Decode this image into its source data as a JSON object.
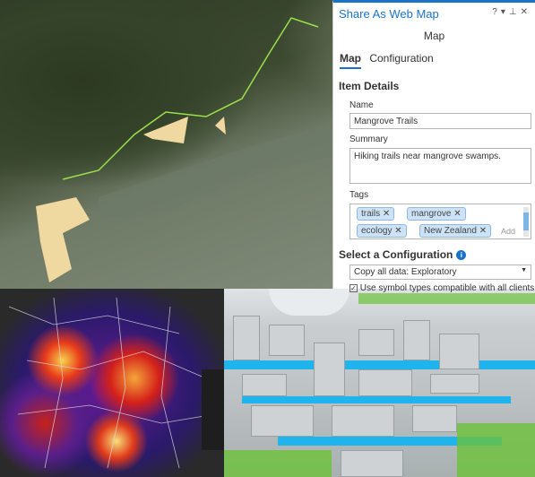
{
  "panel": {
    "title": "Share As Web Map",
    "controls": [
      "?",
      "▾",
      "⊥",
      "✕"
    ],
    "subtitle": "Map",
    "tabs": [
      {
        "label": "Map",
        "active": true
      },
      {
        "label": "Configuration",
        "active": false
      }
    ],
    "section_item_details": "Item Details",
    "name_label": "Name",
    "name_value": "Mangrove Trails",
    "summary_label": "Summary",
    "summary_value": "Hiking trails near mangrove swamps.",
    "tags_label": "Tags",
    "tags": [
      "trails",
      "mangrove",
      "ecology",
      "New Zealand"
    ],
    "tags_add_placeholder": "Add",
    "config_heading": "Select a Configuration",
    "config_value": "Copy all data: Exploratory",
    "checkbox_label": "Use symbol types compatible with all clients",
    "checkbox_checked": true
  },
  "colors": {
    "accent": "#1a73c8",
    "tag_bg": "#cde3f5"
  }
}
